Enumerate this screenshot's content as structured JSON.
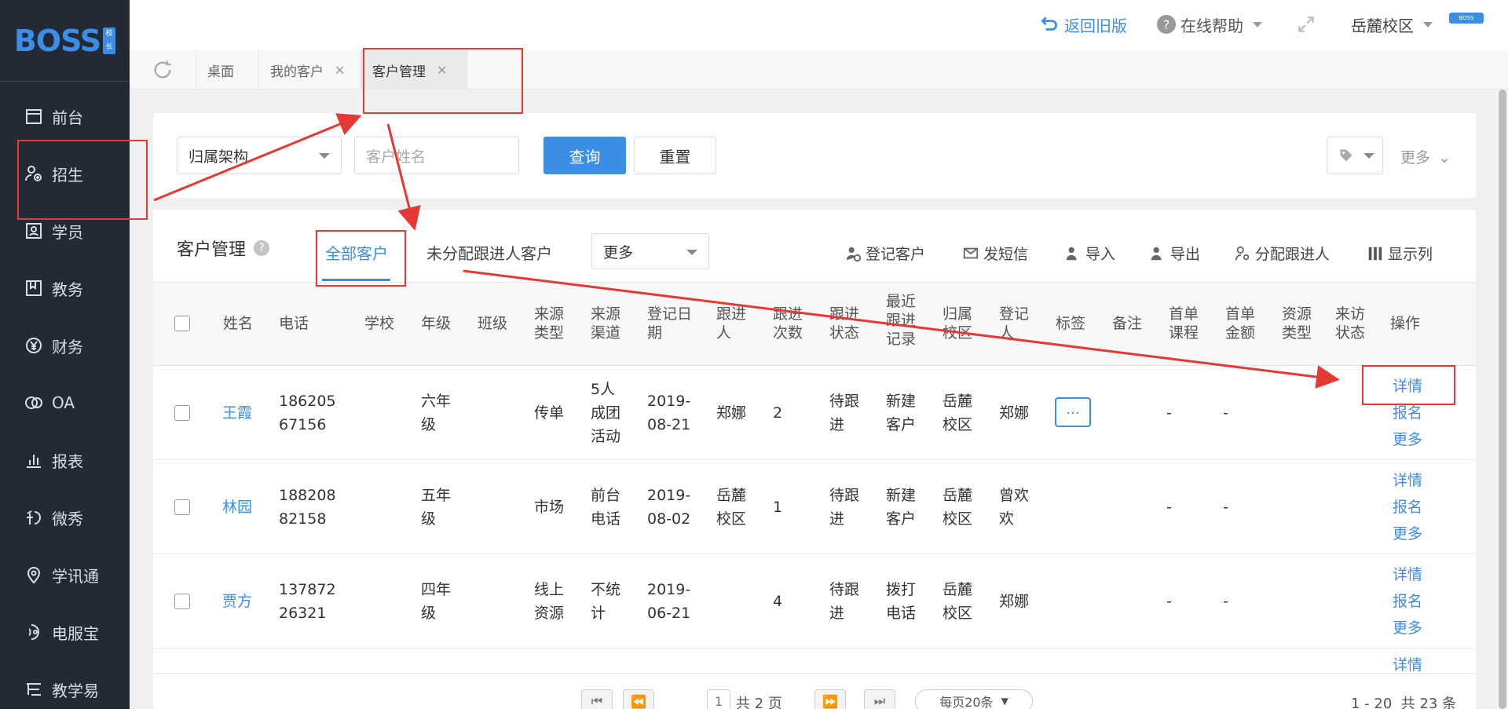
{
  "brand": {
    "logo": "BOSS",
    "badge": "校长"
  },
  "sidebar": {
    "items": [
      {
        "label": "前台",
        "icon": "calendar-icon"
      },
      {
        "label": "招生",
        "icon": "add-user-icon"
      },
      {
        "label": "学员",
        "icon": "id-card-icon"
      },
      {
        "label": "教务",
        "icon": "book-icon"
      },
      {
        "label": "财务",
        "icon": "yen-icon"
      },
      {
        "label": "OA",
        "icon": "oa-icon"
      },
      {
        "label": "报表",
        "icon": "bar-chart-icon"
      },
      {
        "label": "微秀",
        "icon": "weixiu-icon"
      },
      {
        "label": "学讯通",
        "icon": "location-icon"
      },
      {
        "label": "电服宝",
        "icon": "phone-icon"
      },
      {
        "label": "教学易",
        "icon": "teach-icon"
      }
    ]
  },
  "topbar": {
    "back_label": "返回旧版",
    "help_label": "在线帮助",
    "campus_label": "岳麓校区",
    "avatar_text": "BOSS"
  },
  "tabs": [
    {
      "label": "桌面",
      "closable": false
    },
    {
      "label": "我的客户",
      "closable": true
    },
    {
      "label": "客户管理",
      "closable": true
    }
  ],
  "filter": {
    "org_select": "归属架构",
    "name_placeholder": "客户姓名",
    "query_label": "查询",
    "reset_label": "重置",
    "more_label": "更多"
  },
  "main": {
    "title": "客户管理",
    "subtabs": [
      "全部客户",
      "未分配跟进人客户"
    ],
    "more_select": "更多",
    "actions": [
      "登记客户",
      "发短信",
      "导入",
      "导出",
      "分配跟进人",
      "显示列"
    ]
  },
  "table": {
    "headers": [
      "姓名",
      "电话",
      "学校",
      "年级",
      "班级",
      "来源类型",
      "来源渠道",
      "登记日期",
      "跟进人",
      "跟进次数",
      "跟进状态",
      "最近跟进记录",
      "归属校区",
      "登记人",
      "标签",
      "备注",
      "首单课程",
      "首单金额",
      "资源类型",
      "来访状态",
      "操作"
    ],
    "rows": [
      {
        "name": "王霞",
        "phone": "18620567156",
        "grade": "六年级",
        "src_type": "传单",
        "src_channel": "5人成团活动",
        "date": "2019-08-21",
        "follower": "郑娜",
        "count": "2",
        "status": "待跟进",
        "recent": "新建客户",
        "campus": "岳麓校区",
        "registrar": "郑娜",
        "tag": "...",
        "course": "-",
        "amount": "-"
      },
      {
        "name": "林园",
        "phone": "18820882158",
        "grade": "五年级",
        "src_type": "市场",
        "src_channel": "前台电话",
        "date": "2019-08-02",
        "follower": "岳麓校区",
        "count": "1",
        "status": "待跟进",
        "recent": "新建客户",
        "campus": "岳麓校区",
        "registrar": "曾欢欢",
        "tag": "",
        "course": "-",
        "amount": "-"
      },
      {
        "name": "贾方",
        "phone": "13787226321",
        "grade": "四年级",
        "src_type": "线上资源",
        "src_channel": "不统计",
        "date": "2019-06-21",
        "follower": "",
        "count": "4",
        "status": "待跟进",
        "recent": "拨打电话",
        "campus": "岳麓校区",
        "registrar": "郑娜",
        "tag": "",
        "course": "-",
        "amount": "-"
      }
    ],
    "ops": [
      "详情",
      "报名",
      "更多"
    ],
    "partial_op": "详情"
  },
  "pagination": {
    "page": "1",
    "total_pages": "共 2 页",
    "page_size": "每页20条",
    "summary": "1 - 20  共 23 条"
  },
  "colors": {
    "accent": "#3a8ee6",
    "sidebar_bg": "#232a35",
    "annotation": "#e53935"
  }
}
